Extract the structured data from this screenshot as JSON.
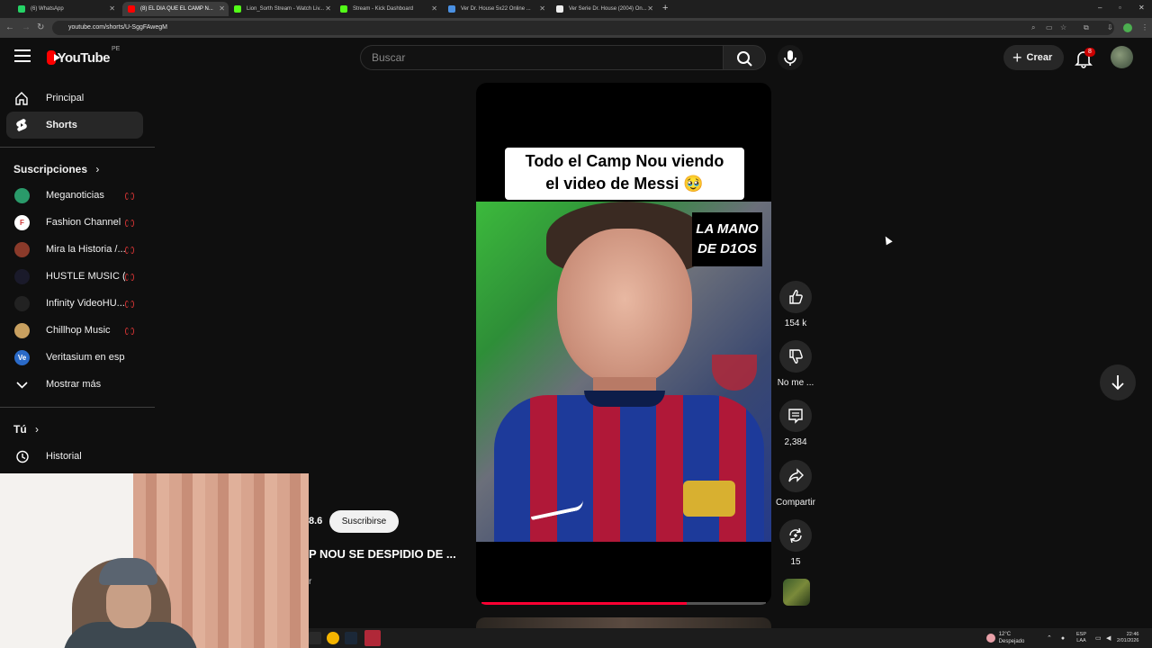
{
  "browser": {
    "tabs": [
      {
        "label": "(6) WhatsApp",
        "favicon_color": "#25d366"
      },
      {
        "label": "(8) EL DIA QUE EL CAMP N...",
        "favicon_color": "#ff0000"
      },
      {
        "label": "Lion_Sorth Stream - Watch Liv...",
        "favicon_color": "#53fc18"
      },
      {
        "label": "Stream - Kick Dashboard",
        "favicon_color": "#53fc18"
      },
      {
        "label": "Ver Dr. House 5x22 Online ...",
        "favicon_color": "#4a90e2"
      },
      {
        "label": "Ver Serie Dr. House (2004) On...",
        "favicon_color": "#eeeeee"
      }
    ],
    "url": "youtube.com/shorts/U-SggFAwegM"
  },
  "header": {
    "logo_text": "YouTube",
    "country": "PE",
    "search_placeholder": "Buscar",
    "create_label": "Crear",
    "notification_count": "8"
  },
  "sidebar": {
    "items": [
      {
        "label": "Principal",
        "icon": "home-icon"
      },
      {
        "label": "Shorts",
        "icon": "shorts-icon"
      }
    ],
    "subscriptions_title": "Suscripciones",
    "subscriptions": [
      {
        "label": "Meganoticias",
        "avatar_text": "",
        "color": "#2a9a6a"
      },
      {
        "label": "Fashion Channel",
        "avatar_text": "F",
        "color": "#ffffff"
      },
      {
        "label": "Mira la Historia /...",
        "avatar_text": "",
        "color": "#8a3a2a"
      },
      {
        "label": "HUSTLE MUSIC (...",
        "avatar_text": "",
        "color": "#1a1a2a"
      },
      {
        "label": "Infinity VideoHU...",
        "avatar_text": "",
        "color": "#222222"
      },
      {
        "label": "Chillhop Music",
        "avatar_text": "",
        "color": "#c8a060"
      },
      {
        "label": "Veritasium en espa...",
        "avatar_text": "Ve",
        "color": "#2a6ac8"
      }
    ],
    "show_more": "Mostrar más",
    "you_title": "Tú",
    "history": "Historial"
  },
  "player": {
    "caption_line1": "Todo el Camp Nou viendo",
    "caption_line2": "el video de Messi 🥹",
    "overlay_line1": "LA MANO",
    "overlay_line2": "DE D1OS",
    "progress": 0.72
  },
  "actions": {
    "likes": "154 k",
    "dislike": "No me ...",
    "comments": "2,384",
    "share": "Compartir",
    "remix": "15"
  },
  "short_info": {
    "subs_partial": "8.6",
    "subscribe_label": "Suscribirse",
    "title_partial": "P NOU SE DESPIDIO DE ...",
    "snippet": "r"
  },
  "taskbar": {
    "weather_temp": "12°C",
    "weather_desc": "Despejado",
    "lang_top": "ESP",
    "lang_bottom": "LAA",
    "time": "22:46",
    "date": "2/01/2026"
  }
}
